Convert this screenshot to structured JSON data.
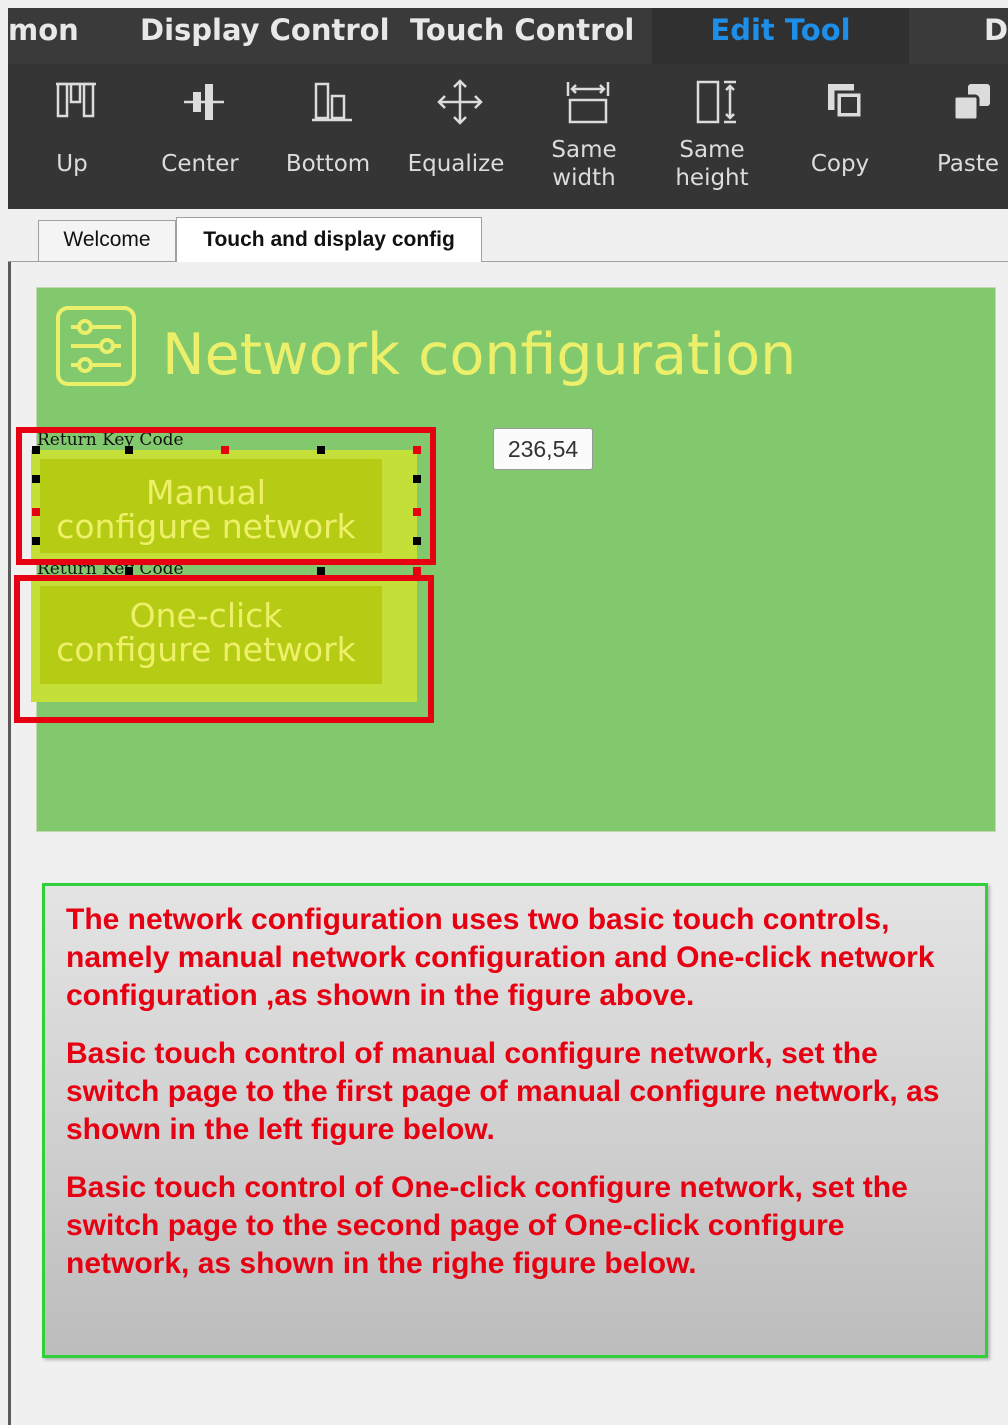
{
  "menu": {
    "items": [
      "mon",
      "Display Control",
      "Touch Control",
      "Edit Tool",
      "D"
    ],
    "active": "Edit Tool"
  },
  "toolbar": {
    "tools": [
      {
        "label": "Up",
        "icon": "align-up-icon"
      },
      {
        "label": "Center",
        "icon": "align-center-icon"
      },
      {
        "label": "Bottom",
        "icon": "align-bottom-icon"
      },
      {
        "label": "Equalize",
        "icon": "equalize-icon"
      },
      {
        "label": "Same\nwidth",
        "icon": "same-width-icon"
      },
      {
        "label": "Same\nheight",
        "icon": "same-height-icon"
      },
      {
        "label": "Copy",
        "icon": "copy-icon"
      },
      {
        "label": "Paste",
        "icon": "paste-icon"
      }
    ]
  },
  "tabs": [
    {
      "label": "Welcome",
      "active": false
    },
    {
      "label": "Touch and display config",
      "active": true
    }
  ],
  "canvas": {
    "title": "Network configuration",
    "icon": "settings-sliders-icon",
    "coord_tooltip": "236,54",
    "controls": [
      {
        "key_label": "Return Key Code",
        "text_line1": "Manual",
        "text_line2": "configure network",
        "selected": true
      },
      {
        "key_label": "Return Key Code",
        "text_line1": "One-click",
        "text_line2": "configure network",
        "selected": false
      }
    ]
  },
  "note": {
    "paragraphs": [
      "The network configuration uses two basic touch controls, namely manual network configuration and One-click network configuration ,as shown in the figure above.",
      "Basic touch control of manual configure network, set the switch page to the first page of manual configure network, as shown in the left figure below.",
      "Basic touch control of One-click configure network, set the switch page to the second page of One-click configure network, as shown in the righe figure below."
    ]
  },
  "colors": {
    "menubar": "#3a3a3a",
    "toolbar": "#353535",
    "menu_active_text": "#1e8fe8",
    "panel_green": "#82c96e",
    "title_yellow": "#ecef6a",
    "button_outer": "#c4e038",
    "button_inner": "#b6cc14",
    "highlight_red": "#e60012",
    "note_border": "#2fd03a",
    "note_text": "#e60012"
  }
}
